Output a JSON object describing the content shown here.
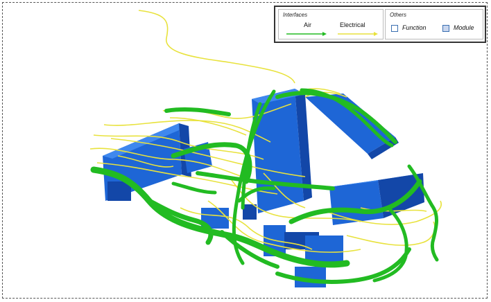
{
  "legend": {
    "interfaces_title": "Interfaces",
    "others_title": "Others",
    "items": {
      "air": "Air",
      "electrical": "Electrical",
      "function": "Function",
      "module": "Module"
    }
  },
  "colors": {
    "air": "#22bb22",
    "electrical": "#e8e23c",
    "module": "#1e66d6",
    "module_dark": "#1347a8",
    "module_light": "#3f88ee"
  }
}
